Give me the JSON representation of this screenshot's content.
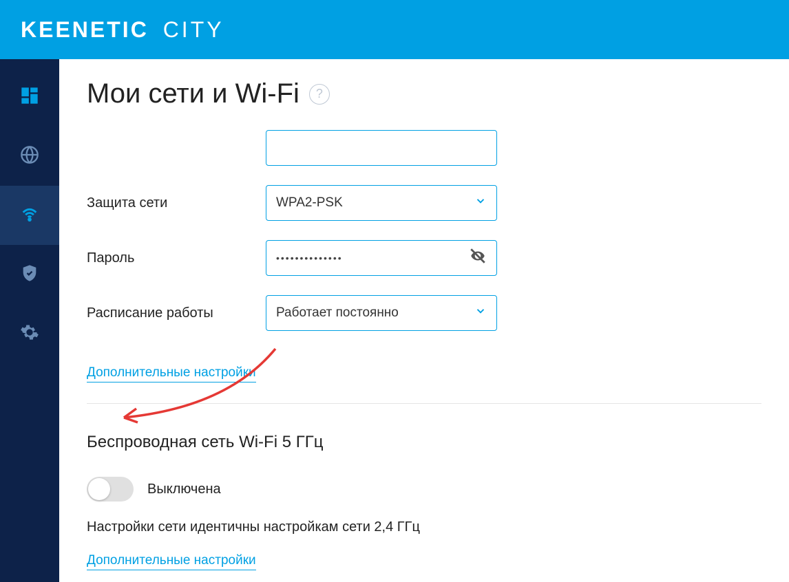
{
  "header": {
    "brand": "KEENETIC",
    "product": "CITY"
  },
  "page": {
    "title": "Мои сети и Wi-Fi"
  },
  "form": {
    "security_label": "Защита сети",
    "security_value": "WPA2-PSK",
    "password_label": "Пароль",
    "password_value": "••••••••••••••",
    "schedule_label": "Расписание работы",
    "schedule_value": "Работает постоянно",
    "more_settings_link": "Дополнительные настройки"
  },
  "wifi5": {
    "section_title": "Беспроводная сеть Wi-Fi 5 ГГц",
    "toggle_state": "Выключена",
    "info": "Настройки сети идентичны настройкам сети 2,4 ГГц",
    "more_settings_link": "Дополнительные настройки"
  }
}
